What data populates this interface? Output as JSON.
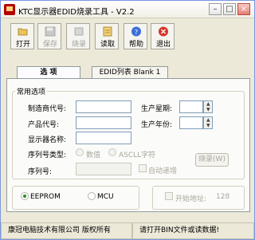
{
  "window": {
    "title": "KTC显示器EDID烧录工具 - V2.2",
    "minimize": "–",
    "maximize": "□",
    "close": "×"
  },
  "toolbar": {
    "open": "打开",
    "save": "保存",
    "burn": "烧录",
    "read": "读取",
    "help": "帮助",
    "exit": "退出"
  },
  "tabs": {
    "options": "选 项",
    "edid_list": "EDID列表 Blank 1"
  },
  "common": {
    "title": "常用选项",
    "manufacturer": "制造商代号:",
    "product": "产品代号:",
    "display_name": "显示器名称:",
    "serial_type": "序列号类型:",
    "serial_num": "序列号:",
    "week": "生产星期:",
    "year": "生产年份:",
    "radio_decimal": "数值",
    "radio_ascii": "ASCLL字符",
    "auto_inc": "自动递增",
    "burn_w": "烧录(W)"
  },
  "memory": {
    "eeprom": "EEPROM",
    "mcu": "MCU"
  },
  "start_addr": {
    "label": "开始地址:",
    "value": "128"
  },
  "status": {
    "company": "康冠电脑技术有限公司 版权所有",
    "message": "请打开BIN文件或读数据!"
  }
}
